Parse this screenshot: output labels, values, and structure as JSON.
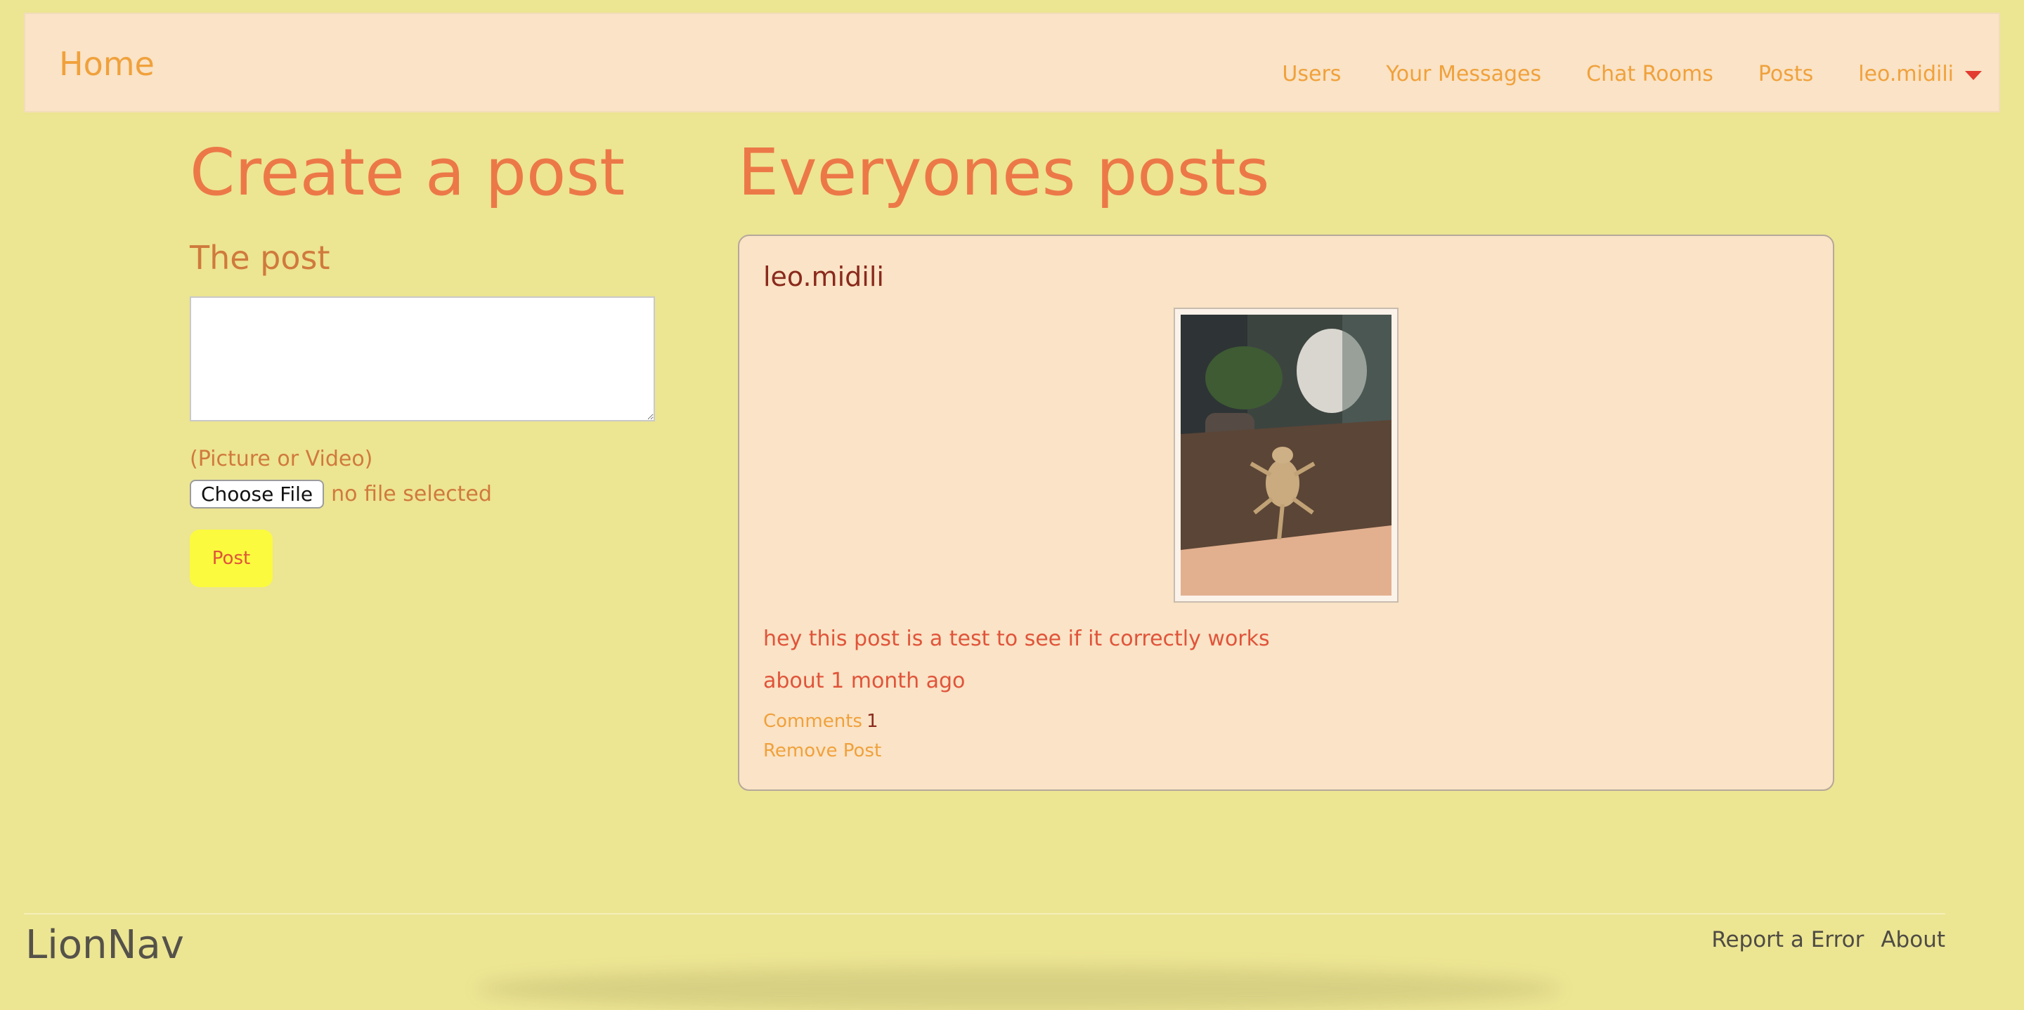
{
  "navbar": {
    "brand": "Home",
    "links": [
      "Users",
      "Your Messages",
      "Chat Rooms",
      "Posts"
    ],
    "user": "leo.midili",
    "user_menu_icon": "chevron-down-icon"
  },
  "create": {
    "heading": "Create a post",
    "field_label": "The post",
    "textarea_value": "",
    "file_hint": "(Picture or Video)",
    "choose_file_label": "Choose File",
    "file_status": "no file selected",
    "submit_label": "Post"
  },
  "feed": {
    "heading": "Everyones posts",
    "posts": [
      {
        "author": "leo.midili",
        "text": "hey this post is a test to see if it correctly works",
        "time": "about 1 month ago",
        "comments_label": "Comments",
        "comments_count": "1",
        "remove_label": "Remove Post"
      }
    ]
  },
  "footer": {
    "brand": "LionNav",
    "links": [
      "Report a Error",
      "About"
    ]
  },
  "colors": {
    "page_bg": "#ece592",
    "navbar_bg": "#fae3c6",
    "heading": "#ec7848",
    "link": "#f0a13c",
    "post_button": "#fbfa3e"
  }
}
